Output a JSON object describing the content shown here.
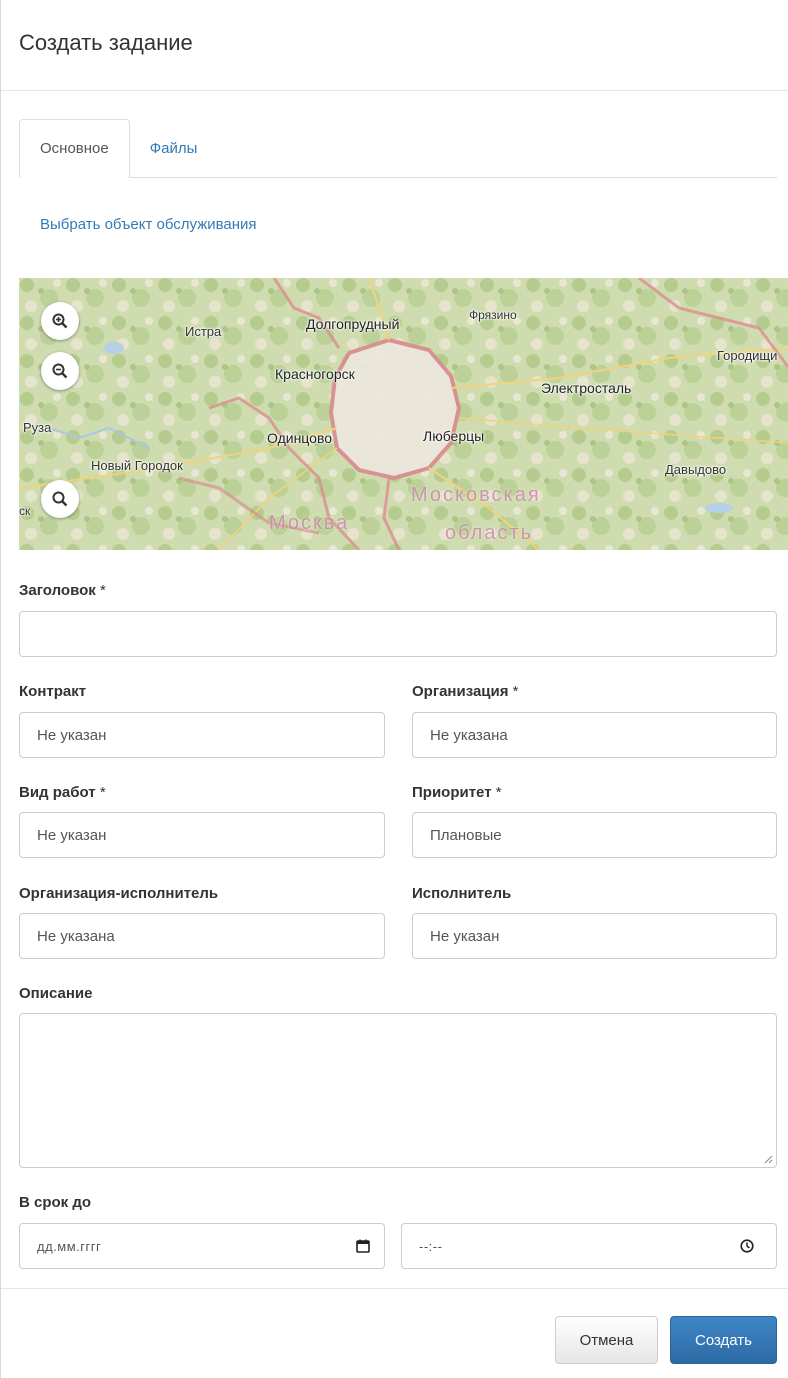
{
  "modal": {
    "title": "Создать задание"
  },
  "tabs": [
    {
      "label": "Основное",
      "active": true
    },
    {
      "label": "Файлы",
      "active": false
    }
  ],
  "select_object_link": "Выбрать объект обслуживания",
  "map": {
    "controls": [
      "zoom-in-icon",
      "zoom-out-icon",
      "search-icon"
    ],
    "places": [
      "Истра",
      "Долгопрудный",
      "Фрязино",
      "Городищи",
      "Красногорск",
      "Электросталь",
      "Руза",
      "Одинцово",
      "Люберцы",
      "Новый Городок",
      "Давыдово",
      "ск",
      "Москва",
      "Московская",
      "область"
    ]
  },
  "form": {
    "title_label": "Заголовок",
    "title_value": "",
    "contract_label": "Контракт",
    "contract_value": "Не указан",
    "organization_label": "Организация",
    "organization_value": "Не указана",
    "work_type_label": "Вид работ",
    "work_type_value": "Не указан",
    "priority_label": "Приоритет",
    "priority_value": "Плановые",
    "executor_org_label": "Организация-исполнитель",
    "executor_org_value": "Не указана",
    "executor_label": "Исполнитель",
    "executor_value": "Не указан",
    "description_label": "Описание",
    "description_value": "",
    "deadline_label": "В срок до",
    "date_placeholder": "дд.мм.гггг",
    "time_placeholder": "--:--",
    "required_mark": "*"
  },
  "buttons": {
    "cancel": "Отмена",
    "create": "Создать"
  },
  "colors": {
    "link": "#337ab7",
    "primary": "#337ab7",
    "border": "#cccccc"
  }
}
